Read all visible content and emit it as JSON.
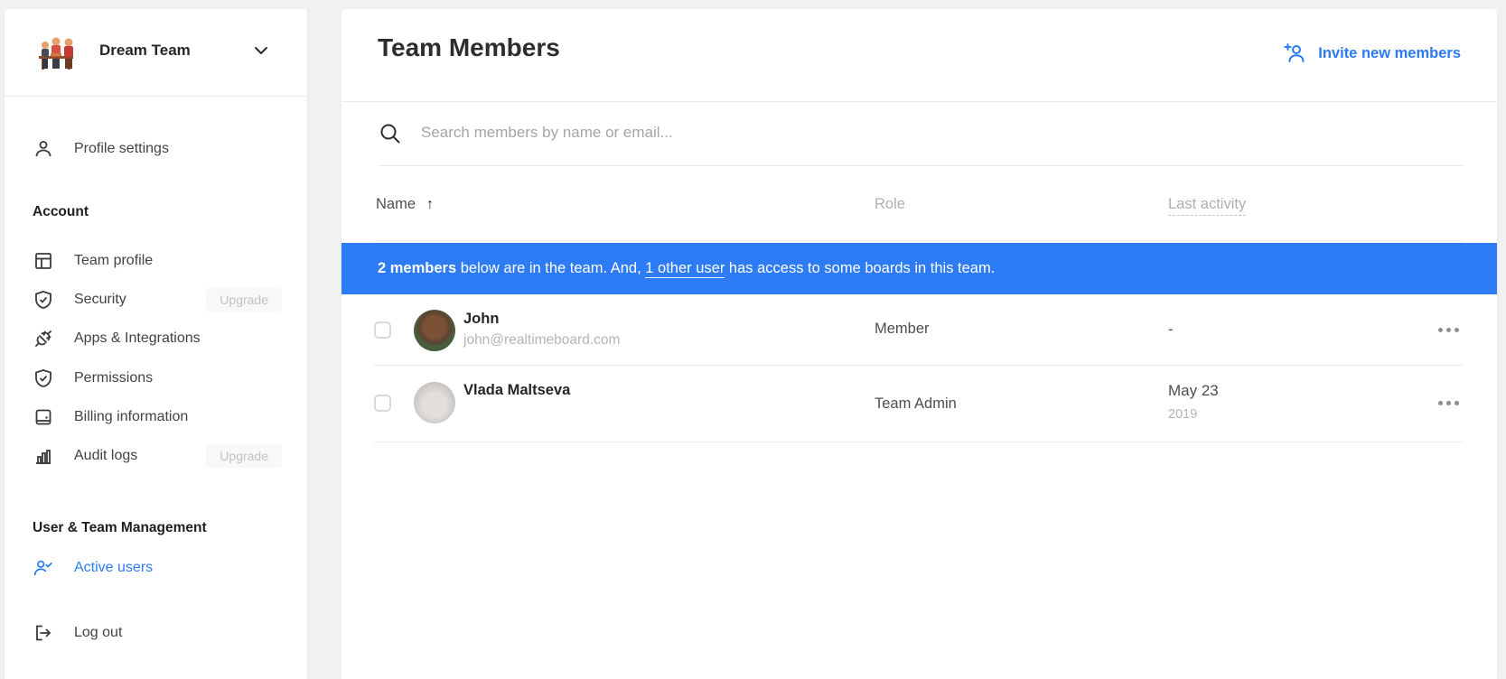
{
  "colors": {
    "accent": "#2e7bf6",
    "banner_bg": "#2e7bf6",
    "page_bg": "#f0f1f2",
    "upgrade_badge_bg": "#f8f8f8"
  },
  "sidebar": {
    "team_name": "Dream Team",
    "team_avatar_icon": "team-illustration-icon",
    "profile": {
      "label": "Profile settings",
      "icon": "person-icon"
    },
    "sections": [
      {
        "heading": "Account",
        "items": [
          {
            "label": "Team profile",
            "icon": "layout-icon"
          },
          {
            "label": "Security",
            "icon": "shield-check-icon",
            "badge": "Upgrade"
          },
          {
            "label": "Apps & Integrations",
            "icon": "plug-icon"
          },
          {
            "label": "Permissions",
            "icon": "shield-check-icon"
          },
          {
            "label": "Billing information",
            "icon": "billing-card-icon"
          },
          {
            "label": "Audit logs",
            "icon": "bar-chart-icon",
            "badge": "Upgrade"
          }
        ]
      },
      {
        "heading": "User & Team Management",
        "items": [
          {
            "label": "Active users",
            "icon": "person-check-icon",
            "active": true
          }
        ]
      }
    ],
    "logout_label": "Log out"
  },
  "header": {
    "title": "Team Members",
    "invite_label": "Invite new members",
    "invite_icon": "add-person-icon"
  },
  "search": {
    "placeholder": "Search members by name or email...",
    "icon": "search-icon"
  },
  "table": {
    "columns": {
      "name": "Name",
      "role": "Role",
      "last_activity": "Last activity"
    },
    "sort_icon": "↑",
    "banner": {
      "bold": "2 members",
      "middle": " below are in the team. And, ",
      "link": "1 other user",
      "rest": " has access to some boards in this team."
    },
    "rows": [
      {
        "name": "John",
        "email": "john@realtimeboard.com",
        "role": "Member",
        "last_activity": "-",
        "last_activity_sub": ""
      },
      {
        "name": "Vlada Maltseva",
        "email": "",
        "role": "Team Admin",
        "last_activity": "May 23",
        "last_activity_sub": "2019"
      }
    ]
  }
}
